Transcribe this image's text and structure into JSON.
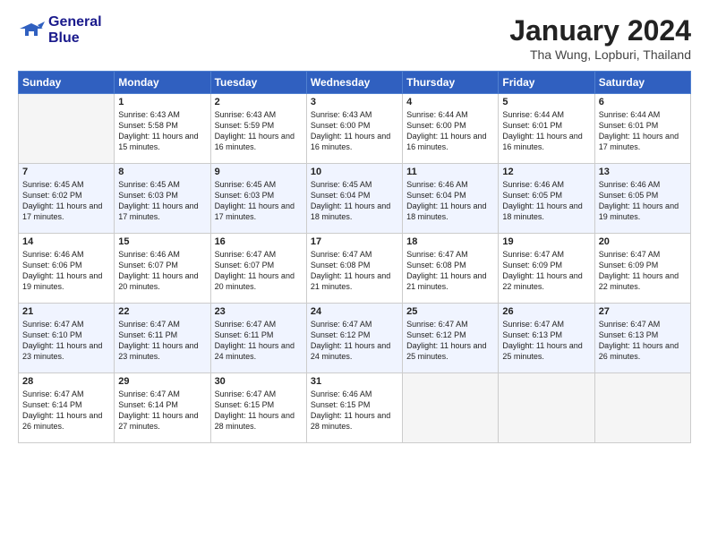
{
  "logo": {
    "line1": "General",
    "line2": "Blue"
  },
  "title": "January 2024",
  "location": "Tha Wung, Lopburi, Thailand",
  "days_of_week": [
    "Sunday",
    "Monday",
    "Tuesday",
    "Wednesday",
    "Thursday",
    "Friday",
    "Saturday"
  ],
  "weeks": [
    [
      {
        "num": "",
        "sunrise": "",
        "sunset": "",
        "daylight": "",
        "empty": true
      },
      {
        "num": "1",
        "sunrise": "Sunrise: 6:43 AM",
        "sunset": "Sunset: 5:58 PM",
        "daylight": "Daylight: 11 hours and 15 minutes."
      },
      {
        "num": "2",
        "sunrise": "Sunrise: 6:43 AM",
        "sunset": "Sunset: 5:59 PM",
        "daylight": "Daylight: 11 hours and 16 minutes."
      },
      {
        "num": "3",
        "sunrise": "Sunrise: 6:43 AM",
        "sunset": "Sunset: 6:00 PM",
        "daylight": "Daylight: 11 hours and 16 minutes."
      },
      {
        "num": "4",
        "sunrise": "Sunrise: 6:44 AM",
        "sunset": "Sunset: 6:00 PM",
        "daylight": "Daylight: 11 hours and 16 minutes."
      },
      {
        "num": "5",
        "sunrise": "Sunrise: 6:44 AM",
        "sunset": "Sunset: 6:01 PM",
        "daylight": "Daylight: 11 hours and 16 minutes."
      },
      {
        "num": "6",
        "sunrise": "Sunrise: 6:44 AM",
        "sunset": "Sunset: 6:01 PM",
        "daylight": "Daylight: 11 hours and 17 minutes."
      }
    ],
    [
      {
        "num": "7",
        "sunrise": "Sunrise: 6:45 AM",
        "sunset": "Sunset: 6:02 PM",
        "daylight": "Daylight: 11 hours and 17 minutes."
      },
      {
        "num": "8",
        "sunrise": "Sunrise: 6:45 AM",
        "sunset": "Sunset: 6:03 PM",
        "daylight": "Daylight: 11 hours and 17 minutes."
      },
      {
        "num": "9",
        "sunrise": "Sunrise: 6:45 AM",
        "sunset": "Sunset: 6:03 PM",
        "daylight": "Daylight: 11 hours and 17 minutes."
      },
      {
        "num": "10",
        "sunrise": "Sunrise: 6:45 AM",
        "sunset": "Sunset: 6:04 PM",
        "daylight": "Daylight: 11 hours and 18 minutes."
      },
      {
        "num": "11",
        "sunrise": "Sunrise: 6:46 AM",
        "sunset": "Sunset: 6:04 PM",
        "daylight": "Daylight: 11 hours and 18 minutes."
      },
      {
        "num": "12",
        "sunrise": "Sunrise: 6:46 AM",
        "sunset": "Sunset: 6:05 PM",
        "daylight": "Daylight: 11 hours and 18 minutes."
      },
      {
        "num": "13",
        "sunrise": "Sunrise: 6:46 AM",
        "sunset": "Sunset: 6:05 PM",
        "daylight": "Daylight: 11 hours and 19 minutes."
      }
    ],
    [
      {
        "num": "14",
        "sunrise": "Sunrise: 6:46 AM",
        "sunset": "Sunset: 6:06 PM",
        "daylight": "Daylight: 11 hours and 19 minutes."
      },
      {
        "num": "15",
        "sunrise": "Sunrise: 6:46 AM",
        "sunset": "Sunset: 6:07 PM",
        "daylight": "Daylight: 11 hours and 20 minutes."
      },
      {
        "num": "16",
        "sunrise": "Sunrise: 6:47 AM",
        "sunset": "Sunset: 6:07 PM",
        "daylight": "Daylight: 11 hours and 20 minutes."
      },
      {
        "num": "17",
        "sunrise": "Sunrise: 6:47 AM",
        "sunset": "Sunset: 6:08 PM",
        "daylight": "Daylight: 11 hours and 21 minutes."
      },
      {
        "num": "18",
        "sunrise": "Sunrise: 6:47 AM",
        "sunset": "Sunset: 6:08 PM",
        "daylight": "Daylight: 11 hours and 21 minutes."
      },
      {
        "num": "19",
        "sunrise": "Sunrise: 6:47 AM",
        "sunset": "Sunset: 6:09 PM",
        "daylight": "Daylight: 11 hours and 22 minutes."
      },
      {
        "num": "20",
        "sunrise": "Sunrise: 6:47 AM",
        "sunset": "Sunset: 6:09 PM",
        "daylight": "Daylight: 11 hours and 22 minutes."
      }
    ],
    [
      {
        "num": "21",
        "sunrise": "Sunrise: 6:47 AM",
        "sunset": "Sunset: 6:10 PM",
        "daylight": "Daylight: 11 hours and 23 minutes."
      },
      {
        "num": "22",
        "sunrise": "Sunrise: 6:47 AM",
        "sunset": "Sunset: 6:11 PM",
        "daylight": "Daylight: 11 hours and 23 minutes."
      },
      {
        "num": "23",
        "sunrise": "Sunrise: 6:47 AM",
        "sunset": "Sunset: 6:11 PM",
        "daylight": "Daylight: 11 hours and 24 minutes."
      },
      {
        "num": "24",
        "sunrise": "Sunrise: 6:47 AM",
        "sunset": "Sunset: 6:12 PM",
        "daylight": "Daylight: 11 hours and 24 minutes."
      },
      {
        "num": "25",
        "sunrise": "Sunrise: 6:47 AM",
        "sunset": "Sunset: 6:12 PM",
        "daylight": "Daylight: 11 hours and 25 minutes."
      },
      {
        "num": "26",
        "sunrise": "Sunrise: 6:47 AM",
        "sunset": "Sunset: 6:13 PM",
        "daylight": "Daylight: 11 hours and 25 minutes."
      },
      {
        "num": "27",
        "sunrise": "Sunrise: 6:47 AM",
        "sunset": "Sunset: 6:13 PM",
        "daylight": "Daylight: 11 hours and 26 minutes."
      }
    ],
    [
      {
        "num": "28",
        "sunrise": "Sunrise: 6:47 AM",
        "sunset": "Sunset: 6:14 PM",
        "daylight": "Daylight: 11 hours and 26 minutes."
      },
      {
        "num": "29",
        "sunrise": "Sunrise: 6:47 AM",
        "sunset": "Sunset: 6:14 PM",
        "daylight": "Daylight: 11 hours and 27 minutes."
      },
      {
        "num": "30",
        "sunrise": "Sunrise: 6:47 AM",
        "sunset": "Sunset: 6:15 PM",
        "daylight": "Daylight: 11 hours and 28 minutes."
      },
      {
        "num": "31",
        "sunrise": "Sunrise: 6:46 AM",
        "sunset": "Sunset: 6:15 PM",
        "daylight": "Daylight: 11 hours and 28 minutes."
      },
      {
        "num": "",
        "sunrise": "",
        "sunset": "",
        "daylight": "",
        "empty": true
      },
      {
        "num": "",
        "sunrise": "",
        "sunset": "",
        "daylight": "",
        "empty": true
      },
      {
        "num": "",
        "sunrise": "",
        "sunset": "",
        "daylight": "",
        "empty": true
      }
    ]
  ]
}
